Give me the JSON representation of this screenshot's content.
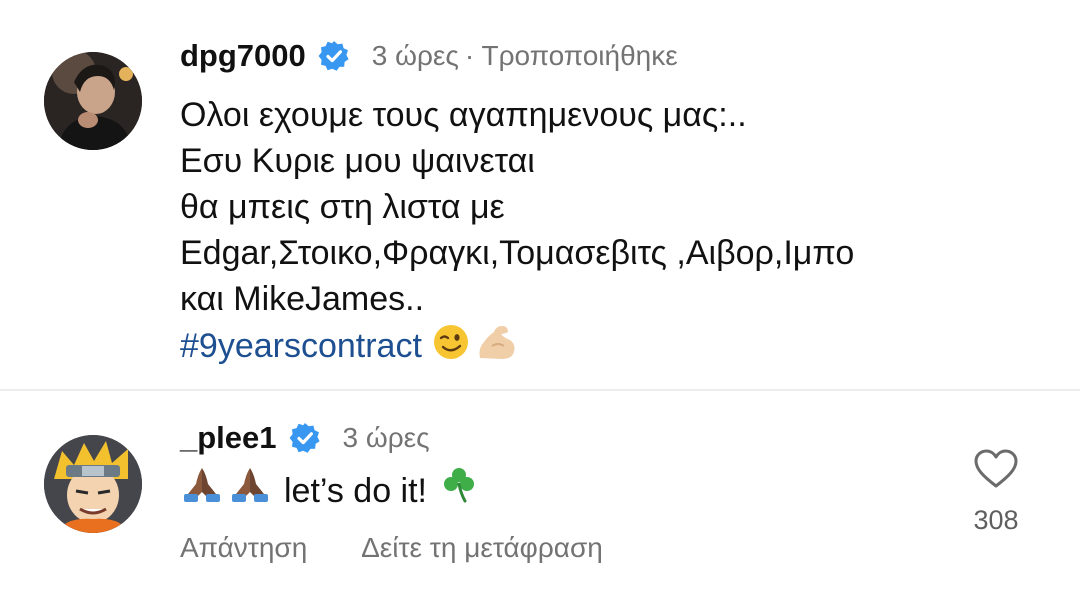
{
  "comments": [
    {
      "username": "dpg7000",
      "time": "3 ώρες",
      "edited": "· Τροποποιήθηκε",
      "lines": [
        "Ολοι εχουμε τους αγαπημενους μας:..",
        "Εσυ Κυριε μου ψαινεται",
        "θα μπεις στη λιστα με",
        "Edgar,Στοικο,Φραγκι,Τομασεβιτς ,Αιβορ,Ιμπο",
        "και MikeJames.."
      ],
      "hashtag": "#9yearscontract",
      "emojis": [
        "winking-face",
        "flexed-biceps"
      ]
    },
    {
      "username": "_plee1",
      "time": "3 ώρες",
      "text": "let’s do it!",
      "emojis": [
        "folded-hands",
        "folded-hands",
        "shamrock"
      ],
      "reply_label": "Απάντηση",
      "translate_label": "Δείτε τη μετάφραση",
      "like_count": "308"
    }
  ],
  "colors": {
    "verified_badge": "#3897f0",
    "hashtag": "#1d4f91",
    "secondary_text": "#737373"
  }
}
